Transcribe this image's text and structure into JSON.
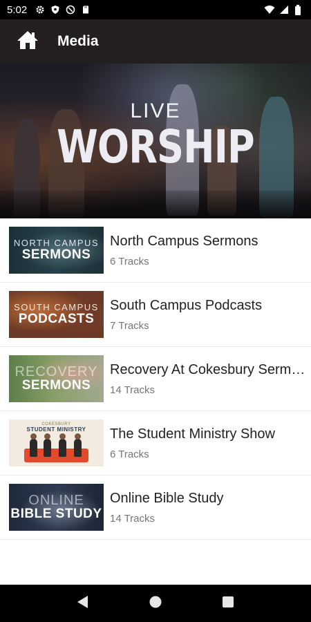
{
  "status_bar": {
    "time": "5:02",
    "icons": [
      "gear-icon",
      "shield-icon",
      "at-sign-icon",
      "sd-card-icon",
      "wifi-icon",
      "signal-icon",
      "battery-icon"
    ]
  },
  "app_bar": {
    "title": "Media",
    "home_icon": "home-icon"
  },
  "hero": {
    "line1": "LIVE",
    "line2": "WORSHIP"
  },
  "media_list": [
    {
      "title": "North Campus Sermons",
      "subtitle": "6 Tracks",
      "thumb_line1": "NORTH CAMPUS",
      "thumb_line2": "SERMONS"
    },
    {
      "title": "South Campus Podcasts",
      "subtitle": "7 Tracks",
      "thumb_line1": "SOUTH CAMPUS",
      "thumb_line2": "PODCASTS"
    },
    {
      "title": "Recovery At Cokesbury Sermons",
      "subtitle": "14 Tracks",
      "thumb_line1": "RECOVERY",
      "thumb_line2": "SERMONS"
    },
    {
      "title": "The Student Ministry Show",
      "subtitle": "6 Tracks",
      "thumb_line1": "COKESBURY",
      "thumb_line2": "STUDENT MINISTRY"
    },
    {
      "title": "Online Bible Study",
      "subtitle": "14 Tracks",
      "thumb_line1": "ONLINE",
      "thumb_line2": "BIBLE STUDY"
    }
  ],
  "nav_bar": {
    "buttons": [
      "back-triangle-icon",
      "home-circle-icon",
      "recents-square-icon"
    ]
  },
  "colors": {
    "app_bar": "#231f1e",
    "status_bar": "#000000",
    "title_text": "#222222",
    "subtitle_text": "#757575"
  }
}
